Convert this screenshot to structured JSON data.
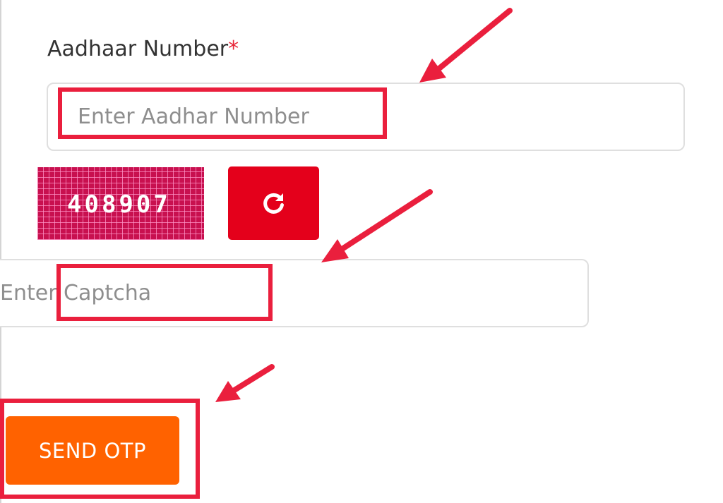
{
  "form": {
    "aadhaar_label": "Aadhaar Number",
    "required_marker": "*",
    "aadhaar_placeholder": "Enter Aadhar Number",
    "captcha_code": "408907",
    "captcha_placeholder": "Enter Captcha",
    "refresh_icon": "refresh-icon",
    "send_otp_label": "SEND OTP"
  },
  "colors": {
    "captcha_background": "#c8104f",
    "refresh_button": "#e4001b",
    "send_otp_button": "#ff6200",
    "annotation_red": "#ea1f3d",
    "required_marker": "#e8283a"
  }
}
